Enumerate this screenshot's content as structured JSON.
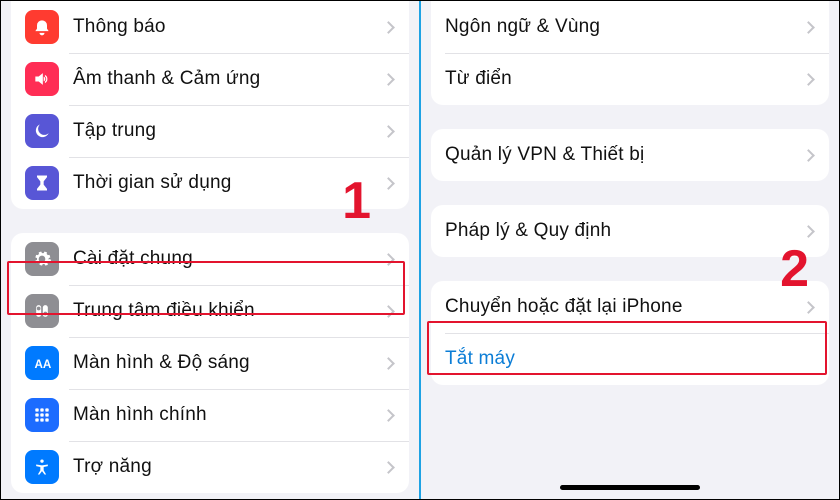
{
  "annotations": {
    "step1": "1",
    "step2": "2"
  },
  "left": {
    "group1": [
      {
        "label": "Thông báo",
        "icon": "bell-icon",
        "color": "bg-red"
      },
      {
        "label": "Âm thanh & Cảm ứng",
        "icon": "speaker-icon",
        "color": "bg-pink"
      },
      {
        "label": "Tập trung",
        "icon": "moon-icon",
        "color": "bg-indigo"
      },
      {
        "label": "Thời gian sử dụng",
        "icon": "hourglass-icon",
        "color": "bg-indigo"
      }
    ],
    "group2": [
      {
        "label": "Cài đặt chung",
        "icon": "gear-icon",
        "color": "bg-gray"
      },
      {
        "label": "Trung tâm điều khiển",
        "icon": "sliders-icon",
        "color": "bg-gray"
      },
      {
        "label": "Màn hình & Độ sáng",
        "icon": "text-size-icon",
        "color": "bg-blue"
      },
      {
        "label": "Màn hình chính",
        "icon": "grid-icon",
        "color": "bg-grid"
      },
      {
        "label": "Trợ năng",
        "icon": "accessibility-icon",
        "color": "bg-blue"
      }
    ]
  },
  "right": {
    "group_lang": [
      {
        "label": "Ngôn ngữ & Vùng"
      },
      {
        "label": "Từ điển"
      }
    ],
    "group_vpn": [
      {
        "label": "Quản lý VPN & Thiết bị"
      }
    ],
    "group_legal": [
      {
        "label": "Pháp lý & Quy định"
      }
    ],
    "group_reset": [
      {
        "label": "Chuyển hoặc đặt lại iPhone",
        "chevron": true
      },
      {
        "label": "Tắt máy",
        "link": true
      }
    ]
  }
}
